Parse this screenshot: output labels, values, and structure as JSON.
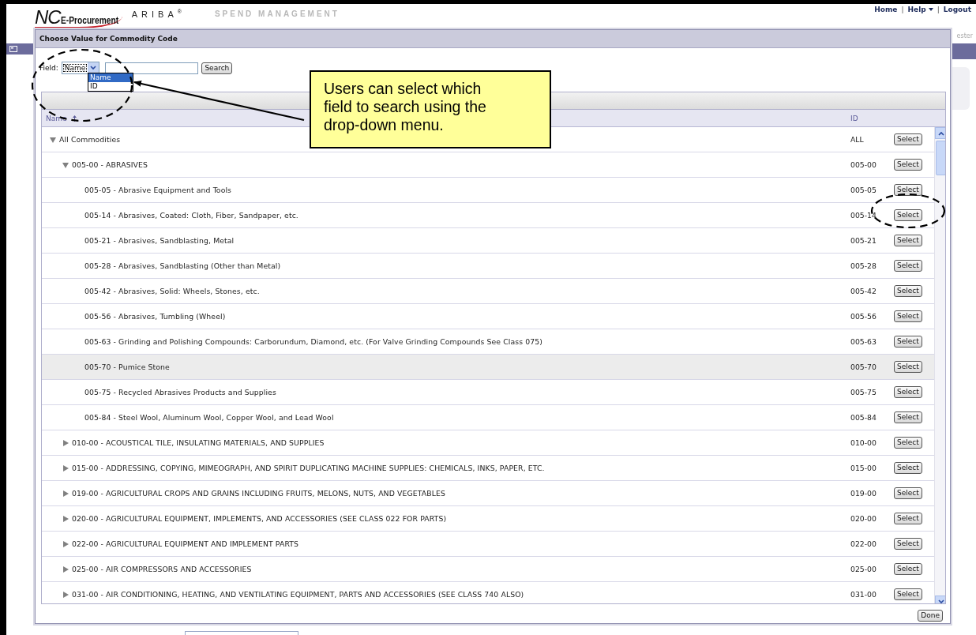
{
  "header": {
    "logo_mark": "NC",
    "logo_text": "E-Procurement",
    "brand": "ARIBA$^{®}$",
    "tagline": "SPEND MANAGEMENT",
    "nav": [
      {
        "kind": "link",
        "label": "Home"
      },
      {
        "kind": "separator",
        "label": "|"
      },
      {
        "kind": "menu",
        "label": "Help"
      },
      {
        "kind": "separator",
        "label": "|"
      },
      {
        "kind": "link",
        "label": "Logout"
      }
    ],
    "user_fragment": "ester"
  },
  "dialog": {
    "title": "Choose Value for Commodity Code",
    "search": {
      "label": "Field:",
      "value": "Name",
      "options": [
        {
          "label": "Name",
          "selected": true
        },
        {
          "label": "ID",
          "selected": false
        }
      ],
      "button": "Search"
    },
    "columns": [
      {
        "label": "Name",
        "sorted": true
      },
      {
        "label": "ID",
        "sorted": false
      }
    ],
    "tree": [
      {
        "name": "All Commodities",
        "id": "ALL",
        "button": "Select",
        "expanded": true,
        "selected": false,
        "children": [
          {
            "name": "005-00 - ABRASIVES",
            "id": "005-00",
            "button": "Select",
            "expanded": true,
            "selected": false,
            "children": [
              {
                "name": "005-05 - Abrasive Equipment and Tools",
                "id": "005-05",
                "button": "Select",
                "selected": false
              },
              {
                "name": "005-14 - Abrasives, Coated: Cloth, Fiber, Sandpaper, etc.",
                "id": "005-14",
                "button": "Select",
                "selected": false
              },
              {
                "name": "005-21 - Abrasives, Sandblasting, Metal",
                "id": "005-21",
                "button": "Select",
                "selected": false
              },
              {
                "name": "005-28 - Abrasives, Sandblasting (Other than Metal)",
                "id": "005-28",
                "button": "Select",
                "selected": false
              },
              {
                "name": "005-42 - Abrasives, Solid: Wheels, Stones, etc.",
                "id": "005-42",
                "button": "Select",
                "selected": false
              },
              {
                "name": "005-56 - Abrasives, Tumbling (Wheel)",
                "id": "005-56",
                "button": "Select",
                "selected": false
              },
              {
                "name": "005-63 - Grinding and Polishing Compounds: Carborundum, Diamond, etc. (For Valve Grinding Compounds See Class 075)",
                "id": "005-63",
                "button": "Select",
                "selected": false
              },
              {
                "name": "005-70 - Pumice Stone",
                "id": "005-70",
                "button": "Select",
                "selected": true
              },
              {
                "name": "005-75 - Recycled Abrasives Products and Supplies",
                "id": "005-75",
                "button": "Select",
                "selected": false
              },
              {
                "name": "005-84 - Steel Wool, Aluminum Wool, Copper Wool, and Lead Wool",
                "id": "005-84",
                "button": "Select",
                "selected": false
              }
            ]
          },
          {
            "name": "010-00 - ACOUSTICAL TILE, INSULATING MATERIALS, AND SUPPLIES",
            "id": "010-00",
            "button": "Select",
            "expanded": false,
            "selected": false
          },
          {
            "name": "015-00 - ADDRESSING, COPYING, MIMEOGRAPH, AND SPIRIT DUPLICATING MACHINE SUPPLIES: CHEMICALS, INKS, PAPER, ETC.",
            "id": "015-00",
            "button": "Select",
            "expanded": false,
            "selected": false
          },
          {
            "name": "019-00 - AGRICULTURAL CROPS AND GRAINS INCLUDING FRUITS, MELONS, NUTS, AND VEGETABLES",
            "id": "019-00",
            "button": "Select",
            "expanded": false,
            "selected": false
          },
          {
            "name": "020-00 - AGRICULTURAL EQUIPMENT, IMPLEMENTS, AND ACCESSORIES (SEE CLASS 022 FOR PARTS)",
            "id": "020-00",
            "button": "Select",
            "expanded": false,
            "selected": false
          },
          {
            "name": "022-00 - AGRICULTURAL EQUIPMENT AND IMPLEMENT PARTS",
            "id": "022-00",
            "button": "Select",
            "expanded": false,
            "selected": false
          },
          {
            "name": "025-00 - AIR COMPRESSORS AND ACCESSORIES",
            "id": "025-00",
            "button": "Select",
            "expanded": false,
            "selected": false
          },
          {
            "name": "031-00 - AIR CONDITIONING, HEATING, AND VENTILATING EQUIPMENT, PARTS AND ACCESSORIES (SEE CLASS 740 ALSO)",
            "id": "031-00",
            "button": "Select",
            "expanded": false,
            "selected": false
          }
        ]
      }
    ],
    "done_button": "Done"
  },
  "annotation": {
    "callout": "Users can select which field to search using the drop-down menu."
  }
}
